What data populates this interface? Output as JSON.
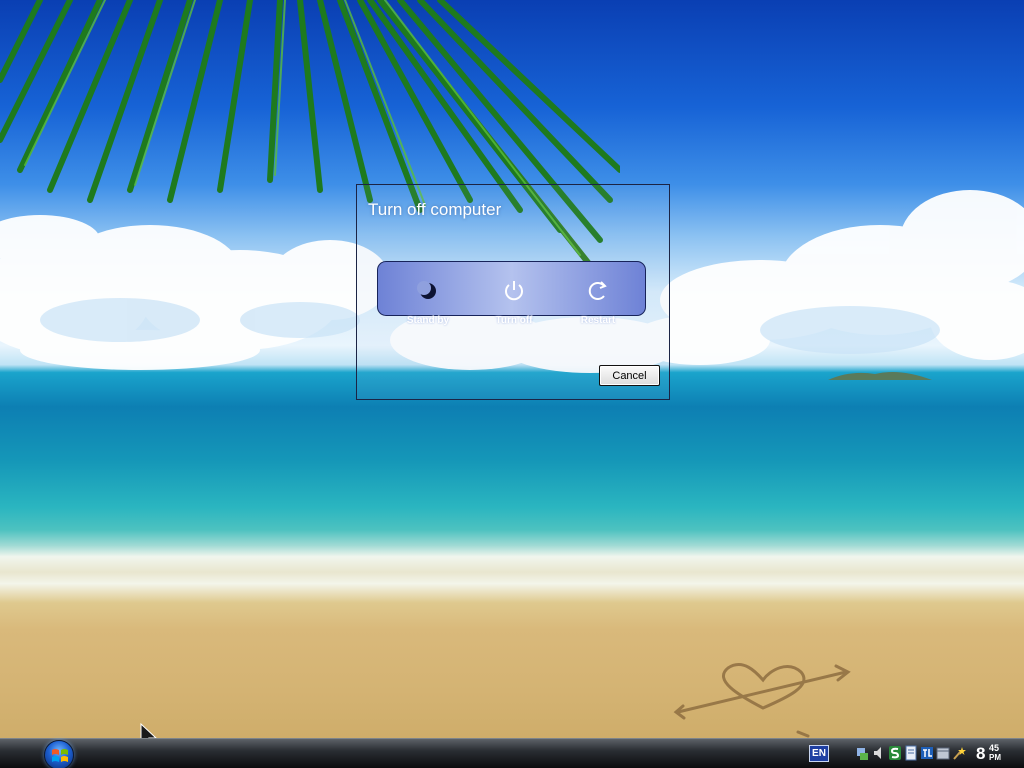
{
  "dialog": {
    "title": "Turn off computer",
    "options": [
      {
        "label": "Stand by",
        "icon": "moon-icon"
      },
      {
        "label": "Turn off",
        "icon": "power-icon"
      },
      {
        "label": "Restart",
        "icon": "restart-arrow-icon"
      }
    ],
    "cancel_label": "Cancel"
  },
  "taskbar": {
    "start_icon": "windows-logo-icon",
    "language": "EN",
    "tray_icons": [
      "network-icon",
      "sound-icon",
      "s-app-icon",
      "document-icon",
      "tl-app-icon",
      "calendar-icon",
      "wand-icon"
    ],
    "clock": {
      "hour": "8",
      "minutes": "45",
      "ampm": "PM"
    }
  },
  "colors": {
    "panel_edge": "#6e82d6",
    "panel_center": "#b4c2ee",
    "taskbar": "#1a1c1f"
  }
}
